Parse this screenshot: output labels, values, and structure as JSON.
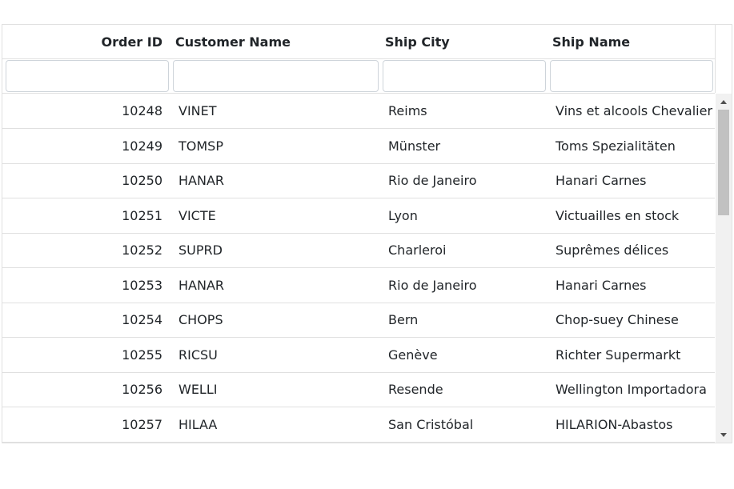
{
  "grid": {
    "columns": [
      {
        "key": "order_id",
        "label": "Order ID"
      },
      {
        "key": "customer_name",
        "label": "Customer Name"
      },
      {
        "key": "ship_city",
        "label": "Ship City"
      },
      {
        "key": "ship_name",
        "label": "Ship Name"
      }
    ],
    "filters": [
      "",
      "",
      "",
      ""
    ],
    "rows": [
      {
        "order_id": "10248",
        "customer_name": "VINET",
        "ship_city": "Reims",
        "ship_name": "Vins et alcools Chevalier"
      },
      {
        "order_id": "10249",
        "customer_name": "TOMSP",
        "ship_city": "Münster",
        "ship_name": "Toms Spezialitäten"
      },
      {
        "order_id": "10250",
        "customer_name": "HANAR",
        "ship_city": "Rio de Janeiro",
        "ship_name": "Hanari Carnes"
      },
      {
        "order_id": "10251",
        "customer_name": "VICTE",
        "ship_city": "Lyon",
        "ship_name": "Victuailles en stock"
      },
      {
        "order_id": "10252",
        "customer_name": "SUPRD",
        "ship_city": "Charleroi",
        "ship_name": "Suprêmes délices"
      },
      {
        "order_id": "10253",
        "customer_name": "HANAR",
        "ship_city": "Rio de Janeiro",
        "ship_name": "Hanari Carnes"
      },
      {
        "order_id": "10254",
        "customer_name": "CHOPS",
        "ship_city": "Bern",
        "ship_name": "Chop-suey Chinese"
      },
      {
        "order_id": "10255",
        "customer_name": "RICSU",
        "ship_city": "Genève",
        "ship_name": "Richter Supermarkt"
      },
      {
        "order_id": "10256",
        "customer_name": "WELLI",
        "ship_city": "Resende",
        "ship_name": "Wellington Importadora"
      },
      {
        "order_id": "10257",
        "customer_name": "HILAA",
        "ship_city": "San Cristóbal",
        "ship_name": "HILARION-Abastos"
      }
    ],
    "scrollbar": {
      "up_icon": "triangle-up-icon",
      "down_icon": "triangle-down-icon"
    }
  },
  "colors": {
    "border": "#e0e0e0",
    "text": "#212529",
    "scroll_track": "#f1f1f1",
    "scroll_thumb": "#c1c1c1"
  }
}
